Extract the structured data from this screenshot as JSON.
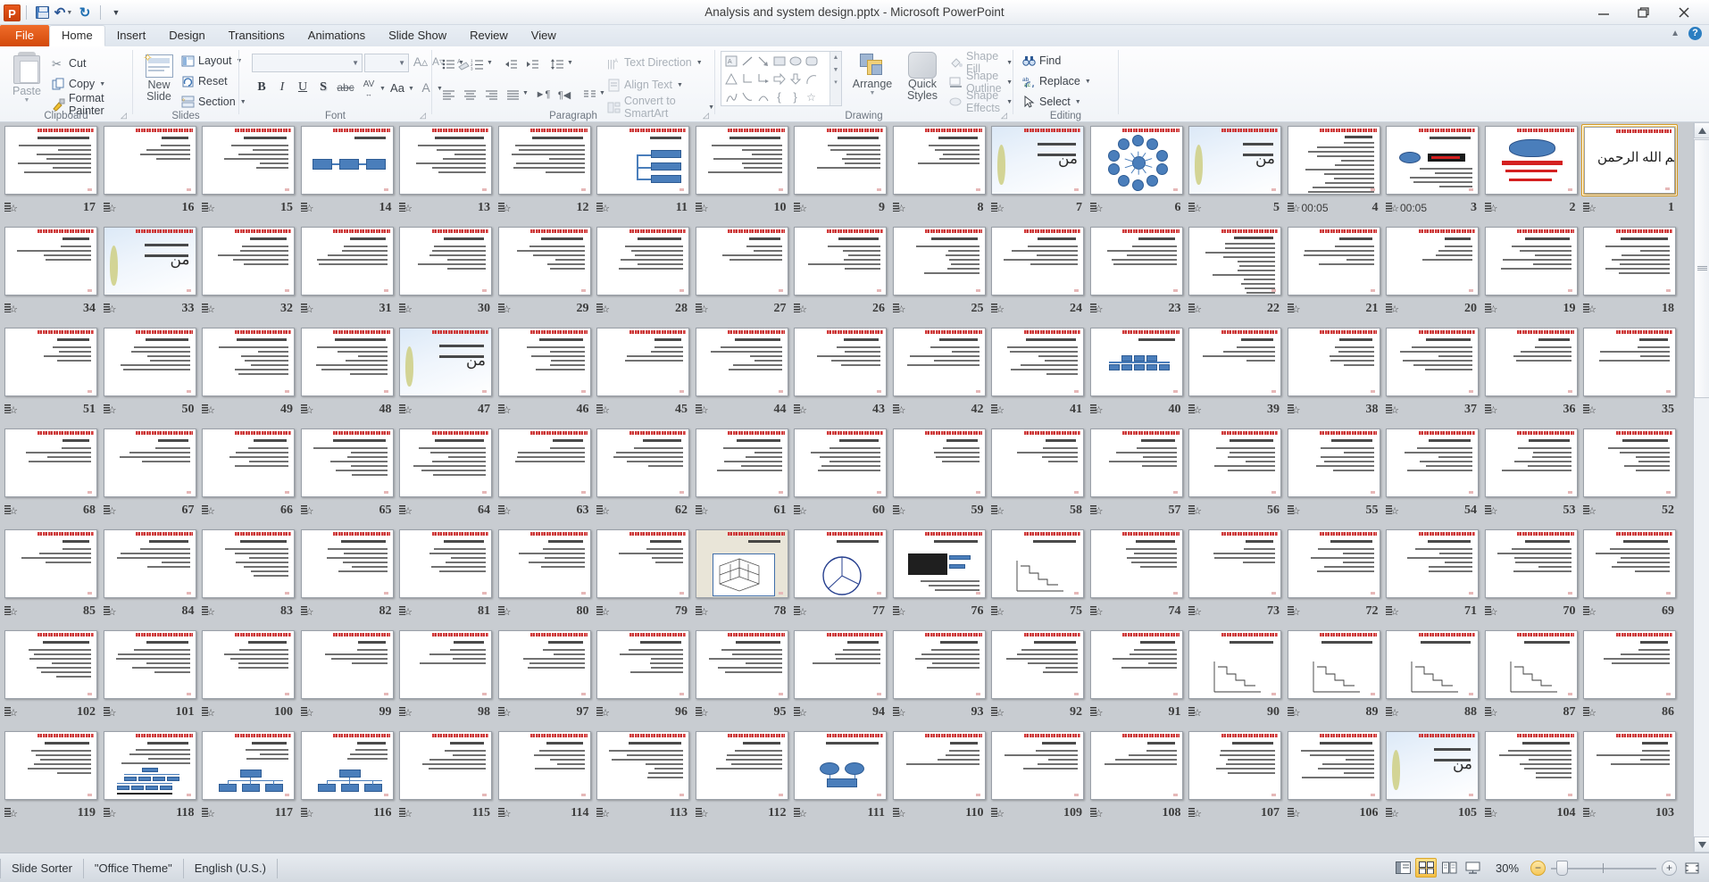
{
  "window": {
    "title": "Analysis and system design.pptx  -  Microsoft PowerPoint",
    "app_logo": "powerpoint-logo",
    "minimize": "minimize-icon",
    "restore": "restore-icon",
    "close": "close-icon"
  },
  "quick_access": {
    "save": "save-icon",
    "undo": "undo-icon",
    "redo": "redo-icon",
    "customize": "customize-qat-icon"
  },
  "ribbon": {
    "tabs": [
      {
        "label": "File",
        "active": false,
        "kind": "file"
      },
      {
        "label": "Home",
        "active": true
      },
      {
        "label": "Insert",
        "active": false
      },
      {
        "label": "Design",
        "active": false
      },
      {
        "label": "Transitions",
        "active": false
      },
      {
        "label": "Animations",
        "active": false
      },
      {
        "label": "Slide Show",
        "active": false
      },
      {
        "label": "Review",
        "active": false
      },
      {
        "label": "View",
        "active": false
      }
    ],
    "collapse_ribbon": "collapse-ribbon-icon",
    "help": "?",
    "groups": {
      "clipboard": {
        "label": "Clipboard",
        "paste": "Paste",
        "cut": "Cut",
        "copy": "Copy",
        "format_painter": "Format Painter"
      },
      "slides": {
        "label": "Slides",
        "new_slide": "New\nSlide",
        "new_slide_line1": "New",
        "new_slide_line2": "Slide",
        "layout": "Layout",
        "reset": "Reset",
        "section": "Section"
      },
      "font": {
        "label": "Font",
        "font_name": "",
        "font_size": "",
        "grow_font": "A",
        "shrink_font": "A",
        "clear_formatting": "clear-formatting-icon",
        "bold": "B",
        "italic": "I",
        "underline": "U",
        "shadow": "S",
        "strikethrough": "abc",
        "character_spacing": "AV",
        "change_case": "Aa",
        "font_color": "A"
      },
      "paragraph": {
        "label": "Paragraph",
        "bullets": "bullets-icon",
        "numbering": "numbering-icon",
        "decrease_indent": "decrease-indent-icon",
        "increase_indent": "increase-indent-icon",
        "line_spacing": "line-spacing-icon",
        "align_left": "align-left-icon",
        "align_center": "align-center-icon",
        "align_right": "align-right-icon",
        "justify": "justify-icon",
        "ltr": "left-to-right-icon",
        "rtl": "right-to-left-icon",
        "columns": "columns-icon",
        "text_direction": "Text Direction",
        "align_text": "Align Text",
        "convert_to_smartart": "Convert to SmartArt"
      },
      "drawing": {
        "label": "Drawing",
        "arrange": "Arrange",
        "quick_styles_line1": "Quick",
        "quick_styles_line2": "Styles",
        "shape_fill": "Shape Fill",
        "shape_outline": "Shape Outline",
        "shape_effects": "Shape Effects"
      },
      "editing": {
        "label": "Editing",
        "find": "Find",
        "replace": "Replace",
        "select": "Select"
      }
    }
  },
  "sorter": {
    "selected_slide": 1,
    "transition_icon": "transition-star-icon",
    "rows": [
      {
        "slides": [
          {
            "n": 17,
            "style": "text",
            "timing": ""
          },
          {
            "n": 16,
            "style": "text",
            "timing": ""
          },
          {
            "n": 15,
            "style": "text",
            "timing": ""
          },
          {
            "n": 14,
            "style": "boxes",
            "timing": ""
          },
          {
            "n": 13,
            "style": "text",
            "timing": ""
          },
          {
            "n": 12,
            "style": "text",
            "timing": ""
          },
          {
            "n": 11,
            "style": "tree",
            "timing": ""
          },
          {
            "n": 10,
            "style": "text",
            "timing": ""
          },
          {
            "n": 9,
            "style": "text",
            "timing": ""
          },
          {
            "n": 8,
            "style": "text",
            "timing": ""
          },
          {
            "n": 7,
            "style": "title",
            "timing": ""
          },
          {
            "n": 6,
            "style": "radial",
            "timing": ""
          },
          {
            "n": 5,
            "style": "title",
            "timing": ""
          },
          {
            "n": 4,
            "style": "dense",
            "timing": "00:05"
          },
          {
            "n": 3,
            "style": "cloudbox",
            "timing": "00:05"
          },
          {
            "n": 2,
            "style": "channel",
            "timing": ""
          },
          {
            "n": 1,
            "style": "bism",
            "timing": ""
          }
        ]
      },
      {
        "slides": [
          {
            "n": 34,
            "style": "text",
            "timing": ""
          },
          {
            "n": 33,
            "style": "title",
            "timing": ""
          },
          {
            "n": 32,
            "style": "text",
            "timing": ""
          },
          {
            "n": 31,
            "style": "text",
            "timing": ""
          },
          {
            "n": 30,
            "style": "text",
            "timing": ""
          },
          {
            "n": 29,
            "style": "text",
            "timing": ""
          },
          {
            "n": 28,
            "style": "text",
            "timing": ""
          },
          {
            "n": 27,
            "style": "text",
            "timing": ""
          },
          {
            "n": 26,
            "style": "text",
            "timing": ""
          },
          {
            "n": 25,
            "style": "text",
            "timing": ""
          },
          {
            "n": 24,
            "style": "text",
            "timing": ""
          },
          {
            "n": 23,
            "style": "text",
            "timing": ""
          },
          {
            "n": 22,
            "style": "dense",
            "timing": ""
          },
          {
            "n": 21,
            "style": "text",
            "timing": ""
          },
          {
            "n": 20,
            "style": "text",
            "timing": ""
          },
          {
            "n": 19,
            "style": "text",
            "timing": ""
          },
          {
            "n": 18,
            "style": "text",
            "timing": ""
          }
        ]
      },
      {
        "slides": [
          {
            "n": 51,
            "style": "text",
            "timing": ""
          },
          {
            "n": 50,
            "style": "text",
            "timing": ""
          },
          {
            "n": 49,
            "style": "text",
            "timing": ""
          },
          {
            "n": 48,
            "style": "text",
            "timing": ""
          },
          {
            "n": 47,
            "style": "title",
            "timing": ""
          },
          {
            "n": 46,
            "style": "text",
            "timing": ""
          },
          {
            "n": 45,
            "style": "text",
            "timing": ""
          },
          {
            "n": 44,
            "style": "text",
            "timing": ""
          },
          {
            "n": 43,
            "style": "text",
            "timing": ""
          },
          {
            "n": 42,
            "style": "text",
            "timing": ""
          },
          {
            "n": 41,
            "style": "text",
            "timing": ""
          },
          {
            "n": 40,
            "style": "pyramid",
            "timing": ""
          },
          {
            "n": 39,
            "style": "text",
            "timing": ""
          },
          {
            "n": 38,
            "style": "text",
            "timing": ""
          },
          {
            "n": 37,
            "style": "text",
            "timing": ""
          },
          {
            "n": 36,
            "style": "text",
            "timing": ""
          },
          {
            "n": 35,
            "style": "text",
            "timing": ""
          }
        ]
      },
      {
        "slides": [
          {
            "n": 68,
            "style": "text",
            "timing": ""
          },
          {
            "n": 67,
            "style": "text",
            "timing": ""
          },
          {
            "n": 66,
            "style": "text",
            "timing": ""
          },
          {
            "n": 65,
            "style": "text",
            "timing": ""
          },
          {
            "n": 64,
            "style": "text",
            "timing": ""
          },
          {
            "n": 63,
            "style": "text",
            "timing": ""
          },
          {
            "n": 62,
            "style": "text",
            "timing": ""
          },
          {
            "n": 61,
            "style": "text",
            "timing": ""
          },
          {
            "n": 60,
            "style": "text",
            "timing": ""
          },
          {
            "n": 59,
            "style": "text",
            "timing": ""
          },
          {
            "n": 58,
            "style": "text",
            "timing": ""
          },
          {
            "n": 57,
            "style": "text",
            "timing": ""
          },
          {
            "n": 56,
            "style": "text",
            "timing": ""
          },
          {
            "n": 55,
            "style": "text",
            "timing": ""
          },
          {
            "n": 54,
            "style": "text",
            "timing": ""
          },
          {
            "n": 53,
            "style": "text",
            "timing": ""
          },
          {
            "n": 52,
            "style": "text",
            "timing": ""
          }
        ]
      },
      {
        "slides": [
          {
            "n": 85,
            "style": "text",
            "timing": ""
          },
          {
            "n": 84,
            "style": "text",
            "timing": ""
          },
          {
            "n": 83,
            "style": "text",
            "timing": ""
          },
          {
            "n": 82,
            "style": "text",
            "timing": ""
          },
          {
            "n": 81,
            "style": "text",
            "timing": ""
          },
          {
            "n": 80,
            "style": "text",
            "timing": ""
          },
          {
            "n": 79,
            "style": "text",
            "timing": ""
          },
          {
            "n": 78,
            "style": "iso3d",
            "timing": ""
          },
          {
            "n": 77,
            "style": "pie",
            "timing": ""
          },
          {
            "n": 76,
            "style": "gantt",
            "timing": ""
          },
          {
            "n": 75,
            "style": "stairs",
            "timing": ""
          },
          {
            "n": 74,
            "style": "text",
            "timing": ""
          },
          {
            "n": 73,
            "style": "text",
            "timing": ""
          },
          {
            "n": 72,
            "style": "text",
            "timing": ""
          },
          {
            "n": 71,
            "style": "text",
            "timing": ""
          },
          {
            "n": 70,
            "style": "text",
            "timing": ""
          },
          {
            "n": 69,
            "style": "text",
            "timing": ""
          }
        ]
      },
      {
        "slides": [
          {
            "n": 102,
            "style": "text",
            "timing": ""
          },
          {
            "n": 101,
            "style": "text",
            "timing": ""
          },
          {
            "n": 100,
            "style": "text",
            "timing": ""
          },
          {
            "n": 99,
            "style": "text",
            "timing": ""
          },
          {
            "n": 98,
            "style": "text",
            "timing": ""
          },
          {
            "n": 97,
            "style": "text",
            "timing": ""
          },
          {
            "n": 96,
            "style": "text",
            "timing": ""
          },
          {
            "n": 95,
            "style": "text",
            "timing": ""
          },
          {
            "n": 94,
            "style": "text",
            "timing": ""
          },
          {
            "n": 93,
            "style": "text",
            "timing": ""
          },
          {
            "n": 92,
            "style": "text",
            "timing": ""
          },
          {
            "n": 91,
            "style": "text",
            "timing": ""
          },
          {
            "n": 90,
            "style": "stairs",
            "timing": ""
          },
          {
            "n": 89,
            "style": "stairs",
            "timing": ""
          },
          {
            "n": 88,
            "style": "stairs",
            "timing": ""
          },
          {
            "n": 87,
            "style": "stairs",
            "timing": ""
          },
          {
            "n": 86,
            "style": "text",
            "timing": ""
          }
        ]
      },
      {
        "slides": [
          {
            "n": 119,
            "style": "text",
            "timing": ""
          },
          {
            "n": 118,
            "style": "orgbig",
            "timing": ""
          },
          {
            "n": 117,
            "style": "org3",
            "timing": ""
          },
          {
            "n": 116,
            "style": "org3",
            "timing": ""
          },
          {
            "n": 115,
            "style": "text",
            "timing": ""
          },
          {
            "n": 114,
            "style": "text",
            "timing": ""
          },
          {
            "n": 113,
            "style": "text",
            "timing": ""
          },
          {
            "n": 112,
            "style": "text",
            "timing": ""
          },
          {
            "n": 111,
            "style": "ovals",
            "timing": ""
          },
          {
            "n": 110,
            "style": "text",
            "timing": ""
          },
          {
            "n": 109,
            "style": "text",
            "timing": ""
          },
          {
            "n": 108,
            "style": "text",
            "timing": ""
          },
          {
            "n": 107,
            "style": "text",
            "timing": ""
          },
          {
            "n": 106,
            "style": "text",
            "timing": ""
          },
          {
            "n": 105,
            "style": "title",
            "timing": ""
          },
          {
            "n": 104,
            "style": "text",
            "timing": ""
          },
          {
            "n": 103,
            "style": "text",
            "timing": ""
          }
        ]
      }
    ]
  },
  "statusbar": {
    "view_name": "Slide Sorter",
    "theme": "\"Office Theme\"",
    "language": "English (U.S.)",
    "views": [
      {
        "name": "normal-view-button",
        "active": false
      },
      {
        "name": "slide-sorter-view-button",
        "active": true
      },
      {
        "name": "reading-view-button",
        "active": false
      },
      {
        "name": "slide-show-button",
        "active": false
      }
    ],
    "zoom_level": "30%",
    "zoom_out": "−",
    "zoom_in": "+",
    "fit_to_window": "fit-slide-to-window-icon"
  }
}
